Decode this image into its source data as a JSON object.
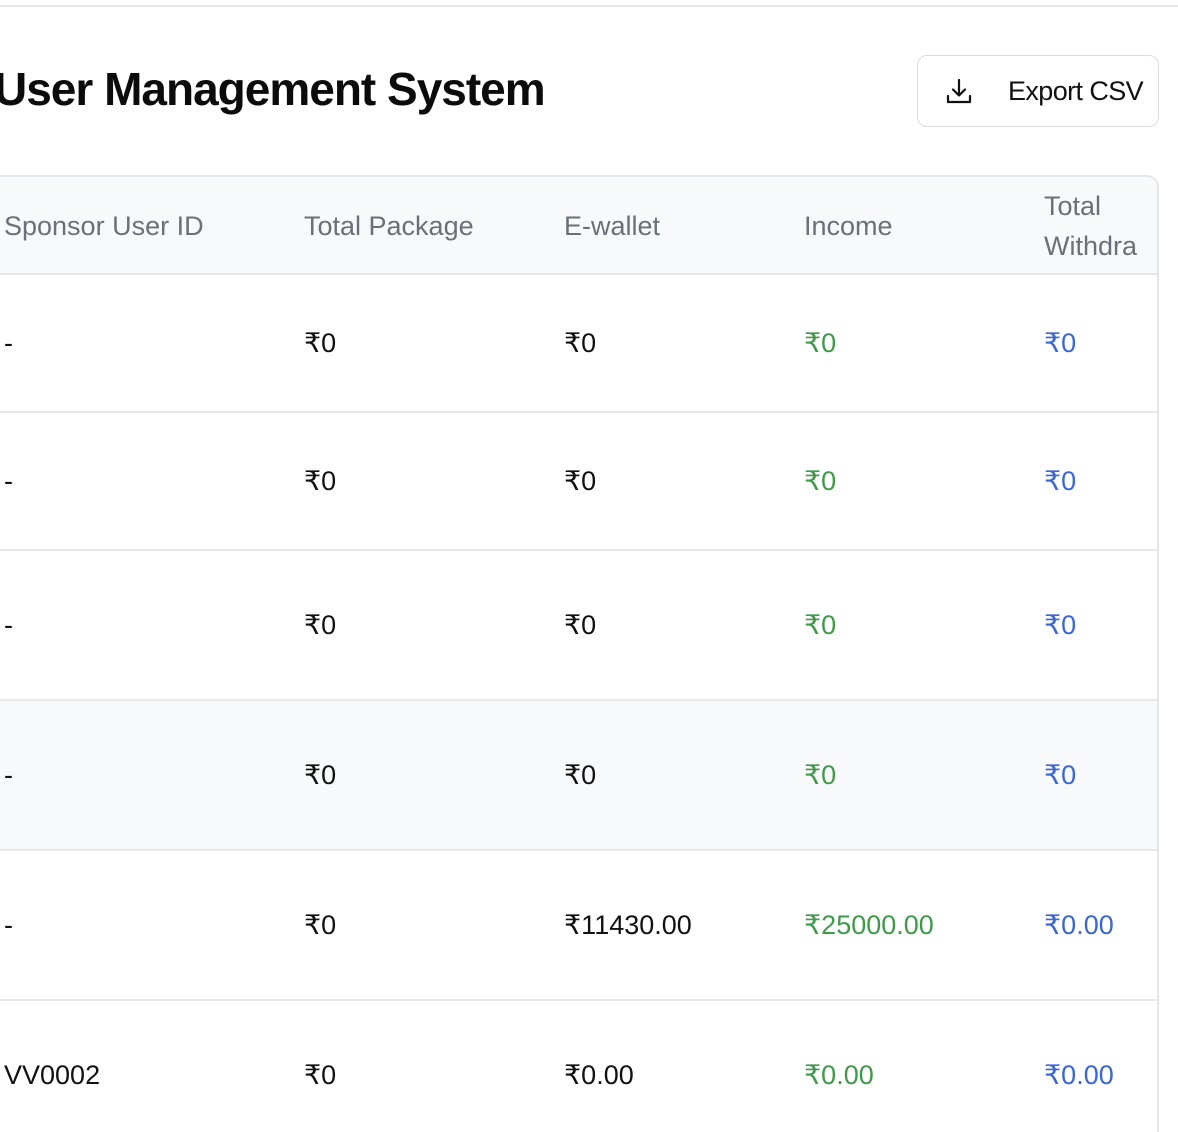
{
  "header": {
    "title": "User Management System",
    "export_button_label": "Export CSV",
    "export_icon": "download-icon"
  },
  "table": {
    "columns": [
      "Sponsor User ID",
      "Total Package",
      "E-wallet",
      "Income",
      "Total Withdraw"
    ],
    "rows": [
      {
        "sponsor_user_id": "-",
        "total_package": "₹0",
        "e_wallet": "₹0",
        "income": "₹0",
        "total_withdraw": "₹0"
      },
      {
        "sponsor_user_id": "-",
        "total_package": "₹0",
        "e_wallet": "₹0",
        "income": "₹0",
        "total_withdraw": "₹0"
      },
      {
        "sponsor_user_id": "-",
        "total_package": "₹0",
        "e_wallet": "₹0",
        "income": "₹0",
        "total_withdraw": "₹0"
      },
      {
        "sponsor_user_id": "-",
        "total_package": "₹0",
        "e_wallet": "₹0",
        "income": "₹0",
        "total_withdraw": "₹0"
      },
      {
        "sponsor_user_id": "-",
        "total_package": "₹0",
        "e_wallet": "₹11430.00",
        "income": "₹25000.00",
        "total_withdraw": "₹0.00"
      },
      {
        "sponsor_user_id": "VV0002",
        "total_package": "₹0",
        "e_wallet": "₹0.00",
        "income": "₹0.00",
        "total_withdraw": "₹0.00"
      }
    ]
  },
  "colors": {
    "income": "#3f9a4a",
    "withdraw": "#3a66d6",
    "header_bg": "#f8f9fa",
    "border": "#e3e6ea"
  }
}
